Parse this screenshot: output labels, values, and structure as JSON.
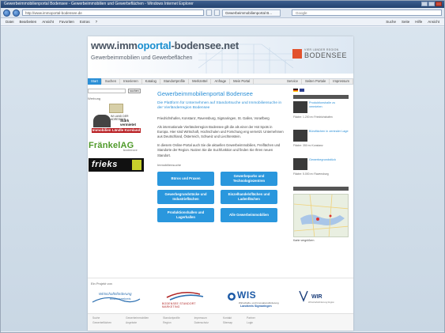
{
  "browser": {
    "title": "Gewerbeimmobilienportal Bodensee - Gewerbeimmobilien und Gewerbeflächen - Windows Internet Explorer",
    "url": "http://www.immoportal-bodensee.de",
    "tab_title": "Gewerbeimmobilienportal B...",
    "search_placeholder": "Google",
    "menu": [
      "Datei",
      "Bearbeiten",
      "Ansicht",
      "Favoriten",
      "Extras",
      "?"
    ],
    "toolbar_right": [
      "Suche",
      "Seite",
      "Hilfe"
    ],
    "zoom": "Ansicht"
  },
  "site": {
    "logo_prefix": "www.imm",
    "logo_mid": "oportal",
    "logo_suffix": "-bodensee.net",
    "subtitle": "Gewerbeimmobilien und Gewerbeflächen",
    "brand_top": "VIER LÄNDER REGION",
    "brand_name": "BODENSEE"
  },
  "nav": {
    "items": [
      "Start",
      "Suchen",
      "Inserieren",
      "Katalog",
      "Standortprofile",
      "Merkzettel",
      "Anfrage",
      "Mein Portal"
    ],
    "right_items": [
      "Service",
      "Seiten Portale",
      "Impressum"
    ]
  },
  "left": {
    "login_button": "suchen",
    "ad_label": "Werbung",
    "ad1_line1": "IM LAND DER ADRESSEN",
    "ad1_line2": "Stark vermietet",
    "ad1_band": "Immobilien Ländle Kornland",
    "ad2_name": "FränkelAG",
    "ad2_sub": "bodensee",
    "ad3_name": "frieks"
  },
  "main": {
    "title": "Gewerbeimmobilienportal Bodensee",
    "intro": "Die Plattform für Unternehmen auf Standortsuche und Immobiliensuche in der Vierländerregion Bodensee",
    "places": "Friedrichshafen, Konstanz, Ravensburg, Sigmaringen, St. Gallen, Vorarlberg",
    "para1": "Als internationale Vierländerregion Bodensee gilt die als einer der Hot Spots in Europa. Hier sind Wirtschaft, Hochschulen und Forschung eng vernetzt. Unternehmen aus Deutschland, Österreich, Schweiz und Liechtenstein.",
    "para2": "In diesem Online-Portal auch Sie die aktuellen Gewerbeimmobilien, Freiflächen und Standorte der Region. Nutzen Sie die Suchfunktion und finden Sie Ihren neuen Standort.",
    "services_label": "Immobiliensuche",
    "services": [
      "Büros und Praxen",
      "Gewerbeparks und Technologiezentren",
      "Gewerbegrundstücke und Industrieflächen",
      "Einzelhandelsflächen und Ladenflächen",
      "Produktionshallen und Lagerhallen",
      "Alle Gewerbeimmobilien"
    ]
  },
  "right": {
    "offers": [
      {
        "title": "Produktionshalle zu vermieten",
        "details": "Fläche: 1.200 m²  Friedrichshafen"
      },
      {
        "title": "Büroflächen in zentraler Lage",
        "details": "Fläche: 350 m²  Konstanz"
      },
      {
        "title": "Gewerbegrundstück",
        "details": "Fläche: 5.000 m²  Ravensburg"
      }
    ],
    "map_link": "Karte vergrößern"
  },
  "partners": {
    "label": "Ein Projekt von",
    "p1_a": "Wirtschaftsförderung",
    "p1_b": "Bodenseekreis",
    "p2": "BODENSEE STANDORT MARKETING",
    "p3_name": "WIS",
    "p3_sub": "Wirtschafts- und Innovationsförderung",
    "p3_sub2": "Landkreis Sigmaringen",
    "p4_name": "WIR",
    "p4_sub": "Wirtschaftsförderung Region"
  },
  "footer": {
    "cols": [
      [
        "Suche",
        "Gewerbeflächen"
      ],
      [
        "Gewerbeimmobilien",
        "Angebote"
      ],
      [
        "Standortprofile",
        "Region"
      ],
      [
        "Impressum",
        "Datenschutz"
      ],
      [
        "Kontakt",
        "Sitemap"
      ],
      [
        "Partner",
        "Login"
      ]
    ]
  },
  "colors": {
    "accent": "#2b8fd6",
    "button": "#2a97dd",
    "brand_red": "#e2522d"
  }
}
